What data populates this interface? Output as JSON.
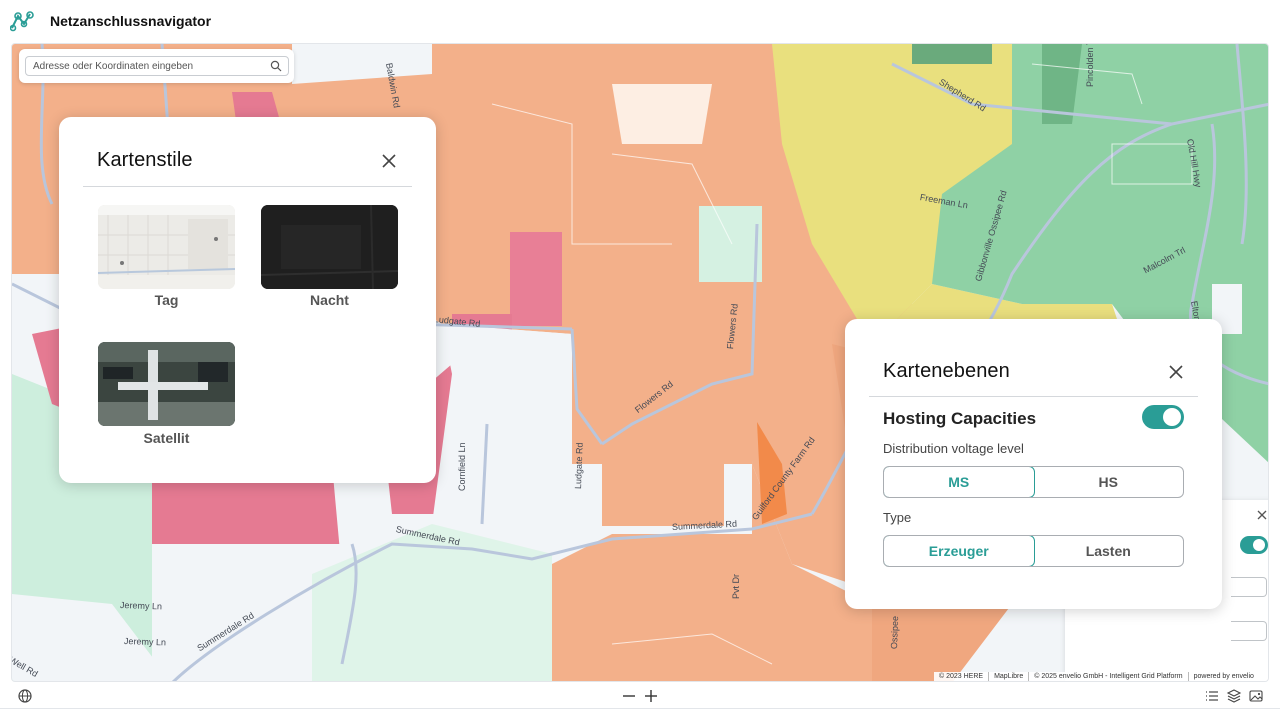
{
  "header": {
    "title": "Netzanschlussnavigator"
  },
  "search": {
    "placeholder": "Adresse oder Koordinaten eingeben"
  },
  "map_styles_panel": {
    "title": "Kartenstile",
    "tiles": [
      {
        "label": "Tag"
      },
      {
        "label": "Nacht"
      },
      {
        "label": "Satellit"
      }
    ]
  },
  "layers_panel": {
    "title": "Kartenebenen",
    "section": "Hosting Capacities",
    "toggle_on": true,
    "voltage_label": "Distribution voltage level",
    "voltage_options": [
      "MS",
      "HS"
    ],
    "voltage_selected": "MS",
    "type_label": "Type",
    "type_options": [
      "Erzeuger",
      "Lasten"
    ],
    "type_selected": "Erzeuger"
  },
  "road_labels": [
    "Baldwin Rd",
    "Shepherd Rd",
    "Pincolden Trl",
    "Old Hill Hwy",
    "Freeman Ln",
    "Gibbonville Ossipee Rd",
    "Malcolm Trl",
    "Elton Ossipee",
    "Ludgate Rd",
    "Flowers Rd",
    "Flowers Rd",
    "Cornfield Ln",
    "Ludgate Rd",
    "Summerdale Rd",
    "Summerdale Rd",
    "Guilford County Farm Rd",
    "Jeremy Ln",
    "Jeremy Ln",
    "Summerdale Rd",
    "Pvt Dr",
    "Ossipee",
    "Well Rd"
  ],
  "attribution": [
    "© 2023 HERE",
    "MapLibre",
    "© 2025 envelio GmbH - Intelligent Grid Platform",
    "powered by envelio"
  ],
  "colors": {
    "accent": "#2a9d96",
    "orange_zone": "#f3b08a",
    "pink_zone": "#e57a92",
    "green_zone": "#8fd1a5",
    "yellow_zone": "#e9df7e",
    "light_zone": "#f3f6f9"
  },
  "icons": {
    "logo": "logo-icon",
    "search": "search-icon",
    "close": "close-icon",
    "globe": "globe-icon",
    "zoom_out": "minus-icon",
    "zoom_in": "plus-icon",
    "list": "list-icon",
    "layers": "layers-icon",
    "image": "image-icon"
  }
}
